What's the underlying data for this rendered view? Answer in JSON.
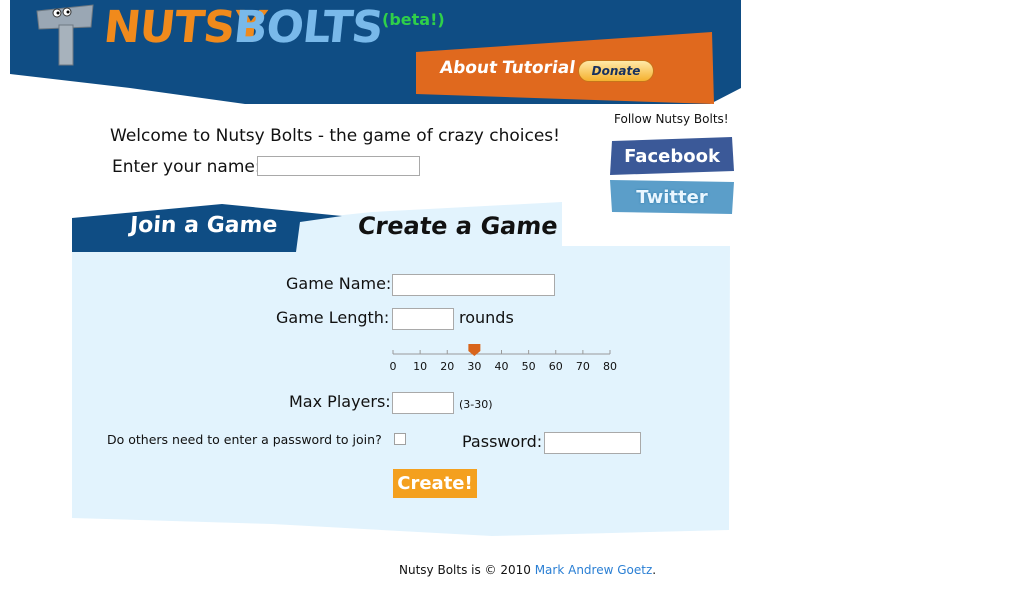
{
  "header": {
    "brand_nutsy": "NUTSY",
    "brand_bolts": "BOLTS",
    "beta": "(beta!)",
    "nav_about": "About",
    "nav_tutorial": "Tutorial",
    "donate_label": "Donate",
    "colors": {
      "header_blue": "#0f4d84",
      "orange": "#e0691e",
      "beta_green": "#2fd04a"
    }
  },
  "welcome": {
    "text": "Welcome to Nutsy Bolts - the game of crazy choices!",
    "name_label": "Enter your name:",
    "name_value": "",
    "name_placeholder": ""
  },
  "social": {
    "follow_text": "Follow Nutsy Bolts!",
    "facebook": "Facebook",
    "twitter": "Twitter"
  },
  "tabs": {
    "join": "Join a Game",
    "create": "Create a Game",
    "active": "create"
  },
  "create_form": {
    "game_name_label": "Game Name:",
    "game_name_value": "",
    "game_length_label": "Game Length:",
    "game_length_value": "",
    "rounds_label": "rounds",
    "slider": {
      "ticks": [
        "0",
        "10",
        "20",
        "30",
        "40",
        "50",
        "60",
        "70",
        "80"
      ],
      "value": 30,
      "min": 0,
      "max": 80
    },
    "max_players_label": "Max Players:",
    "max_players_value": "",
    "max_players_hint": "(3-30)",
    "password_question": "Do others need to enter a password to join?",
    "password_required": false,
    "password_label": "Password:",
    "password_value": "",
    "create_button": "Create!"
  },
  "footer": {
    "prefix": "Nutsy Bolts is © 2010 ",
    "author": "Mark Andrew Goetz",
    "suffix": "."
  }
}
